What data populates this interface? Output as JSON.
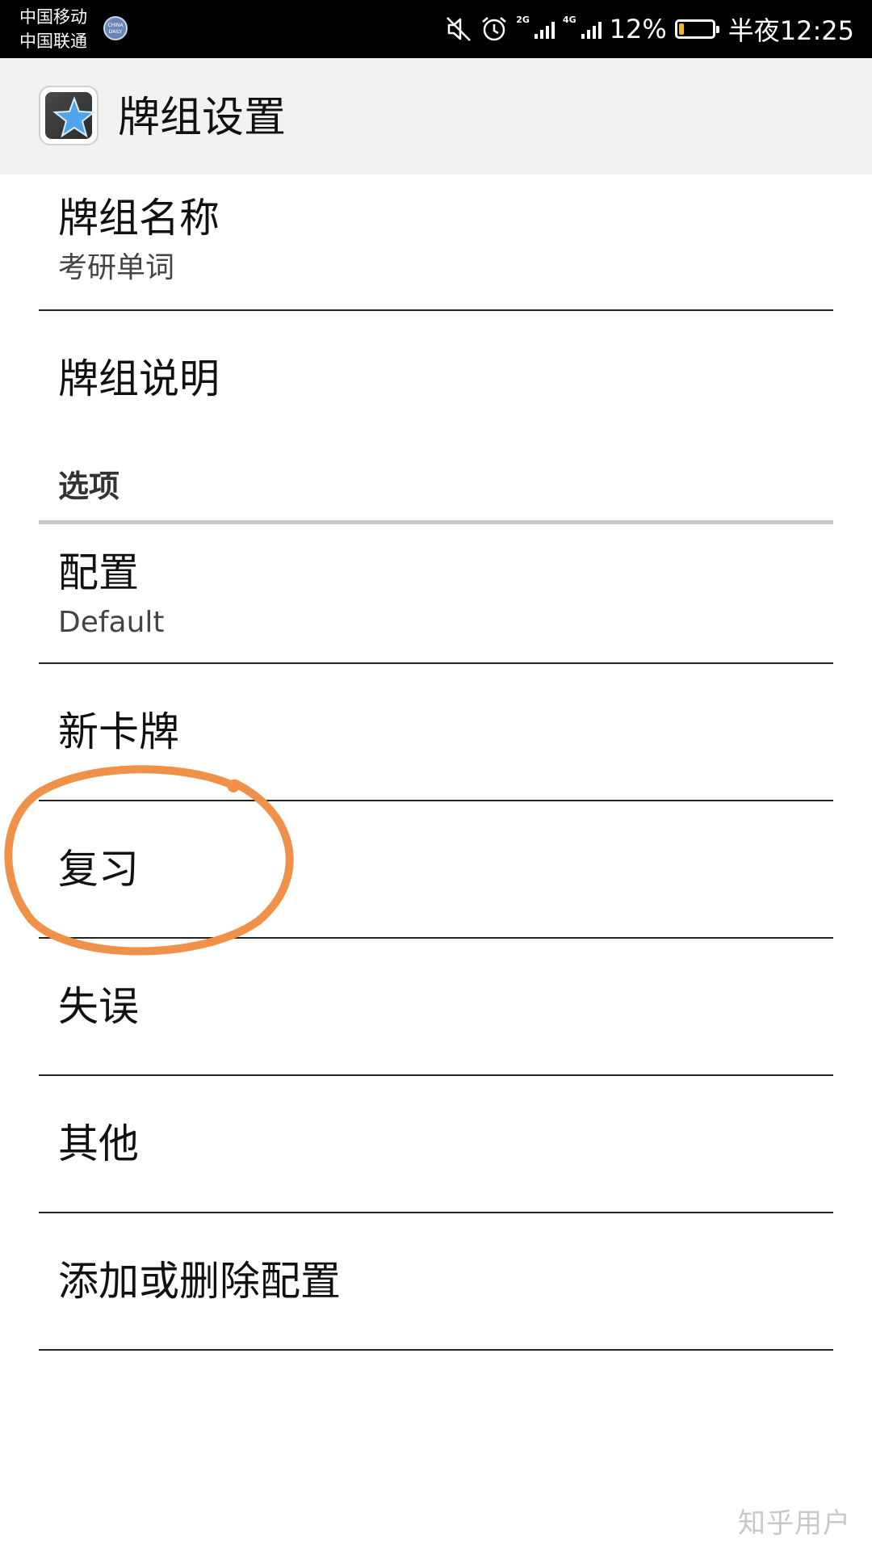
{
  "status_bar": {
    "carrier_1": "中国移动",
    "carrier_2": "中国联通",
    "notification_badge": "CHINA DAILY",
    "net_1": "2G",
    "net_2": "4G",
    "battery_percent": "12%",
    "battery_level": 0.12,
    "battery_color": "#f1b622",
    "time": "半夜12:25",
    "icons": [
      "mute-icon",
      "alarm-icon",
      "signal-icon",
      "signal-icon",
      "battery-icon"
    ]
  },
  "toolbar": {
    "title": "牌组设置",
    "app_icon": "anki-star-icon"
  },
  "preferences": {
    "deck_name": {
      "title": "牌组名称",
      "summary": "考研单词"
    },
    "deck_description": {
      "title": "牌组说明"
    },
    "options_category": "选项",
    "config": {
      "title": "配置",
      "summary": "Default"
    },
    "new_cards": {
      "title": "新卡牌"
    },
    "reviews": {
      "title": "复习"
    },
    "lapses": {
      "title": "失误"
    },
    "general": {
      "title": "其他"
    },
    "manage_configs": {
      "title": "添加或删除配置"
    }
  },
  "annotation": {
    "color": "#f0914a",
    "target": "复习"
  },
  "watermark": "知乎用户"
}
